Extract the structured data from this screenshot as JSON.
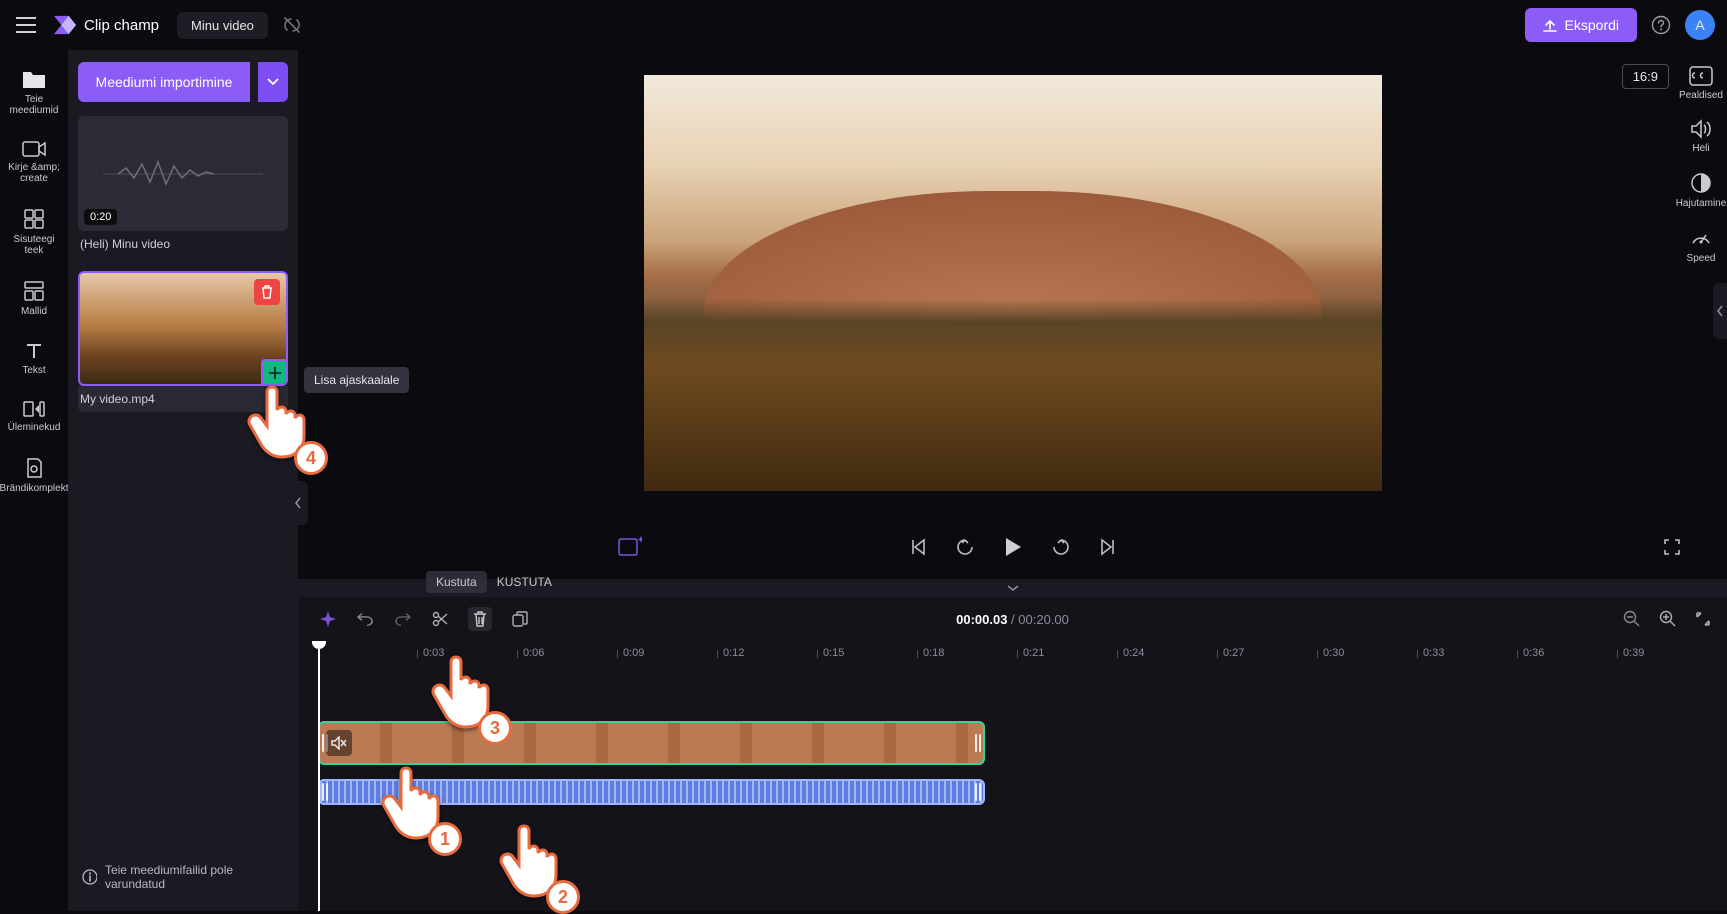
{
  "app": {
    "name": "Clip champ"
  },
  "header": {
    "project_title": "Minu video",
    "export_label": "Ekspordi",
    "avatar_initial": "A"
  },
  "rail": {
    "items": [
      {
        "id": "your-media",
        "label": "Teie meediumid"
      },
      {
        "id": "record",
        "label": "Kirje &amp;\ncreate"
      },
      {
        "id": "content-lib",
        "label": "Sisuteegi\nteek"
      },
      {
        "id": "templates",
        "label": "Mallid"
      },
      {
        "id": "text",
        "label": "Tekst"
      },
      {
        "id": "transitions",
        "label": "Üleminekud"
      },
      {
        "id": "brandkit",
        "label": "Brändikomplekt"
      }
    ]
  },
  "media_panel": {
    "import_label": "Meediumi importimine",
    "audio_item": {
      "duration": "0:20",
      "label": "(Heli) Minu video"
    },
    "video_item": {
      "label": "My video.mp4",
      "add_tooltip": "Lisa ajaskaalale"
    },
    "backup_warning": "Teie meediumifailid pole varundatud"
  },
  "preview": {
    "aspect_ratio": "16:9"
  },
  "right_rail": {
    "items": [
      {
        "id": "captions",
        "label": "Pealdised"
      },
      {
        "id": "audio",
        "label": "Heli"
      },
      {
        "id": "fade",
        "label": "Hajutamine"
      },
      {
        "id": "speed",
        "label": "Speed"
      }
    ]
  },
  "timeline_toolbar": {
    "delete_tooltip": {
      "title": "Kustuta",
      "kbd": "KUSTUTA"
    },
    "current_time": "00:00.03",
    "separator": " / ",
    "total_time": "00:20.00"
  },
  "ruler_ticks": [
    "0:03",
    "0:06",
    "0:09",
    "0:12",
    "0:15",
    "0:18",
    "0:21",
    "0:24",
    "0:27",
    "0:30",
    "0:33",
    "0:36",
    "0:39"
  ],
  "annotations": {
    "p1": "1",
    "p2": "2",
    "p3": "3",
    "p4": "4"
  }
}
